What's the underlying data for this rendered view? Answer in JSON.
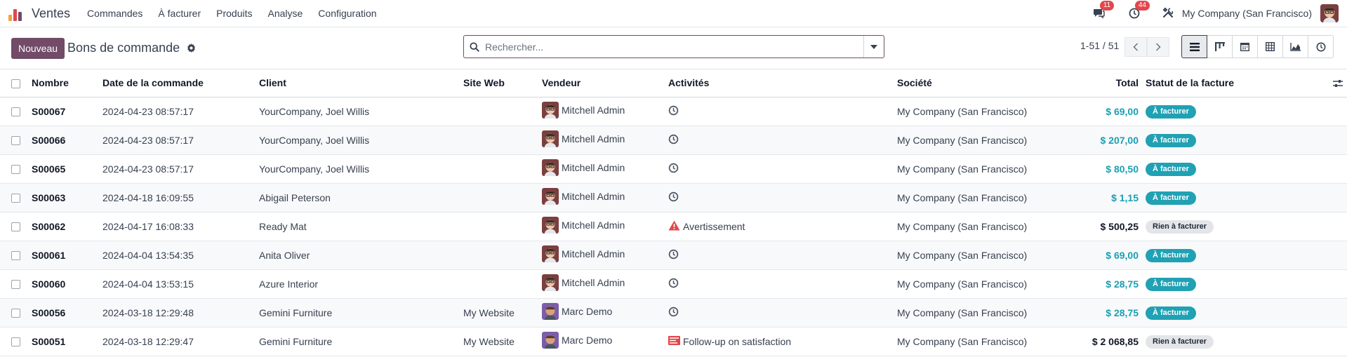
{
  "navbar": {
    "brand": "Ventes",
    "menu": [
      "Commandes",
      "À facturer",
      "Produits",
      "Analyse",
      "Configuration"
    ],
    "messages_count": "11",
    "activities_count": "44",
    "company": "My Company (San Francisco)"
  },
  "control": {
    "new_label": "Nouveau",
    "title": "Bons de commande",
    "search_placeholder": "Rechercher...",
    "pager": "1-51 / 51",
    "views": [
      "list-icon",
      "kanban-icon",
      "calendar-icon",
      "pivot-icon",
      "graph-icon",
      "activity-icon"
    ]
  },
  "table": {
    "headers": {
      "name": "Nombre",
      "date": "Date de la commande",
      "client": "Client",
      "website": "Site Web",
      "seller": "Vendeur",
      "activities": "Activités",
      "company": "Société",
      "total": "Total",
      "invoice_status": "Statut de la facture"
    },
    "rows": [
      {
        "name": "S00067",
        "date": "2024-04-23 08:57:17",
        "client": "YourCompany, Joel Willis",
        "website": "",
        "seller": "Mitchell Admin",
        "activity": "",
        "activity_icon": "clock-icon",
        "company": "My Company (San Francisco)",
        "total": "$ 69,00",
        "status": "À facturer"
      },
      {
        "name": "S00066",
        "date": "2024-04-23 08:57:17",
        "client": "YourCompany, Joel Willis",
        "website": "",
        "seller": "Mitchell Admin",
        "activity": "",
        "activity_icon": "clock-icon",
        "company": "My Company (San Francisco)",
        "total": "$ 207,00",
        "status": "À facturer"
      },
      {
        "name": "S00065",
        "date": "2024-04-23 08:57:17",
        "client": "YourCompany, Joel Willis",
        "website": "",
        "seller": "Mitchell Admin",
        "activity": "",
        "activity_icon": "clock-icon",
        "company": "My Company (San Francisco)",
        "total": "$ 80,50",
        "status": "À facturer"
      },
      {
        "name": "S00063",
        "date": "2024-04-18 16:09:55",
        "client": "Abigail Peterson",
        "website": "",
        "seller": "Mitchell Admin",
        "activity": "",
        "activity_icon": "clock-icon",
        "company": "My Company (San Francisco)",
        "total": "$ 1,15",
        "status": "À facturer"
      },
      {
        "name": "S00062",
        "date": "2024-04-17 16:08:33",
        "client": "Ready Mat",
        "website": "",
        "seller": "Mitchell Admin",
        "activity": "Avertissement",
        "activity_icon": "warning-icon",
        "company": "My Company (San Francisco)",
        "total": "$ 500,25",
        "status": "Rien à facturer"
      },
      {
        "name": "S00061",
        "date": "2024-04-04 13:54:35",
        "client": "Anita Oliver",
        "website": "",
        "seller": "Mitchell Admin",
        "activity": "",
        "activity_icon": "clock-icon",
        "company": "My Company (San Francisco)",
        "total": "$ 69,00",
        "status": "À facturer"
      },
      {
        "name": "S00060",
        "date": "2024-04-04 13:53:15",
        "client": "Azure Interior",
        "website": "",
        "seller": "Mitchell Admin",
        "activity": "",
        "activity_icon": "clock-icon",
        "company": "My Company (San Francisco)",
        "total": "$ 28,75",
        "status": "À facturer"
      },
      {
        "name": "S00056",
        "date": "2024-03-18 12:29:48",
        "client": "Gemini Furniture",
        "website": "My Website",
        "seller": "Marc Demo",
        "activity": "",
        "activity_icon": "clock-icon",
        "company": "My Company (San Francisco)",
        "total": "$ 28,75",
        "status": "À facturer"
      },
      {
        "name": "S00051",
        "date": "2024-03-18 12:29:47",
        "client": "Gemini Furniture",
        "website": "My Website",
        "seller": "Marc Demo",
        "activity": "Follow-up on satisfaction",
        "activity_icon": "follow-up-icon",
        "company": "My Company (San Francisco)",
        "total": "$ 2 068,85",
        "status": "Rien à facturer"
      }
    ]
  },
  "colors": {
    "brand": "#714b67",
    "teal": "#1a9fb2",
    "badge_red": "#e2474b",
    "warning": "#e2474b"
  }
}
